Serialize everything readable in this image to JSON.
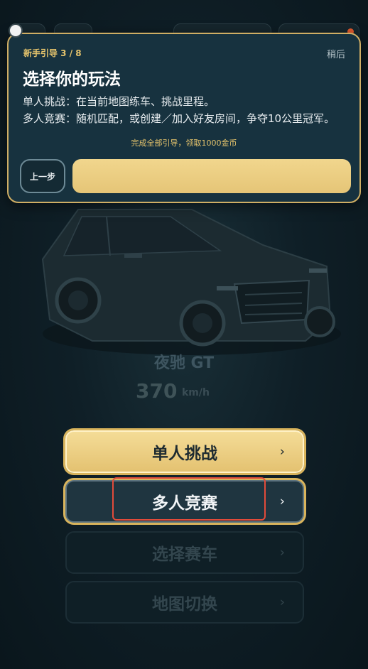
{
  "guide": {
    "step_label": "新手引导 3 / 8",
    "later": "稍后",
    "title": "选择你的玩法",
    "line1": "单人挑战：在当前地图练车、挑战里程。",
    "line2": "多人竞赛：随机匹配，或创建／加入好友房间，争夺10公里冠军。",
    "reward": "完成全部引导，领取1000金币",
    "prev_label": "上一步",
    "next_label": ""
  },
  "car": {
    "name": "夜驰 GT",
    "speed": "370",
    "unit": "km/h"
  },
  "menu": {
    "single": "单人挑战",
    "multi": "多人竞赛",
    "select_car": "选择赛车",
    "switch_map": "地图切换",
    "chevron": "›"
  },
  "colors": {
    "accent_gold": "#e5c577",
    "guide_bg": "#17323f",
    "highlight_red": "#e24b3a"
  }
}
